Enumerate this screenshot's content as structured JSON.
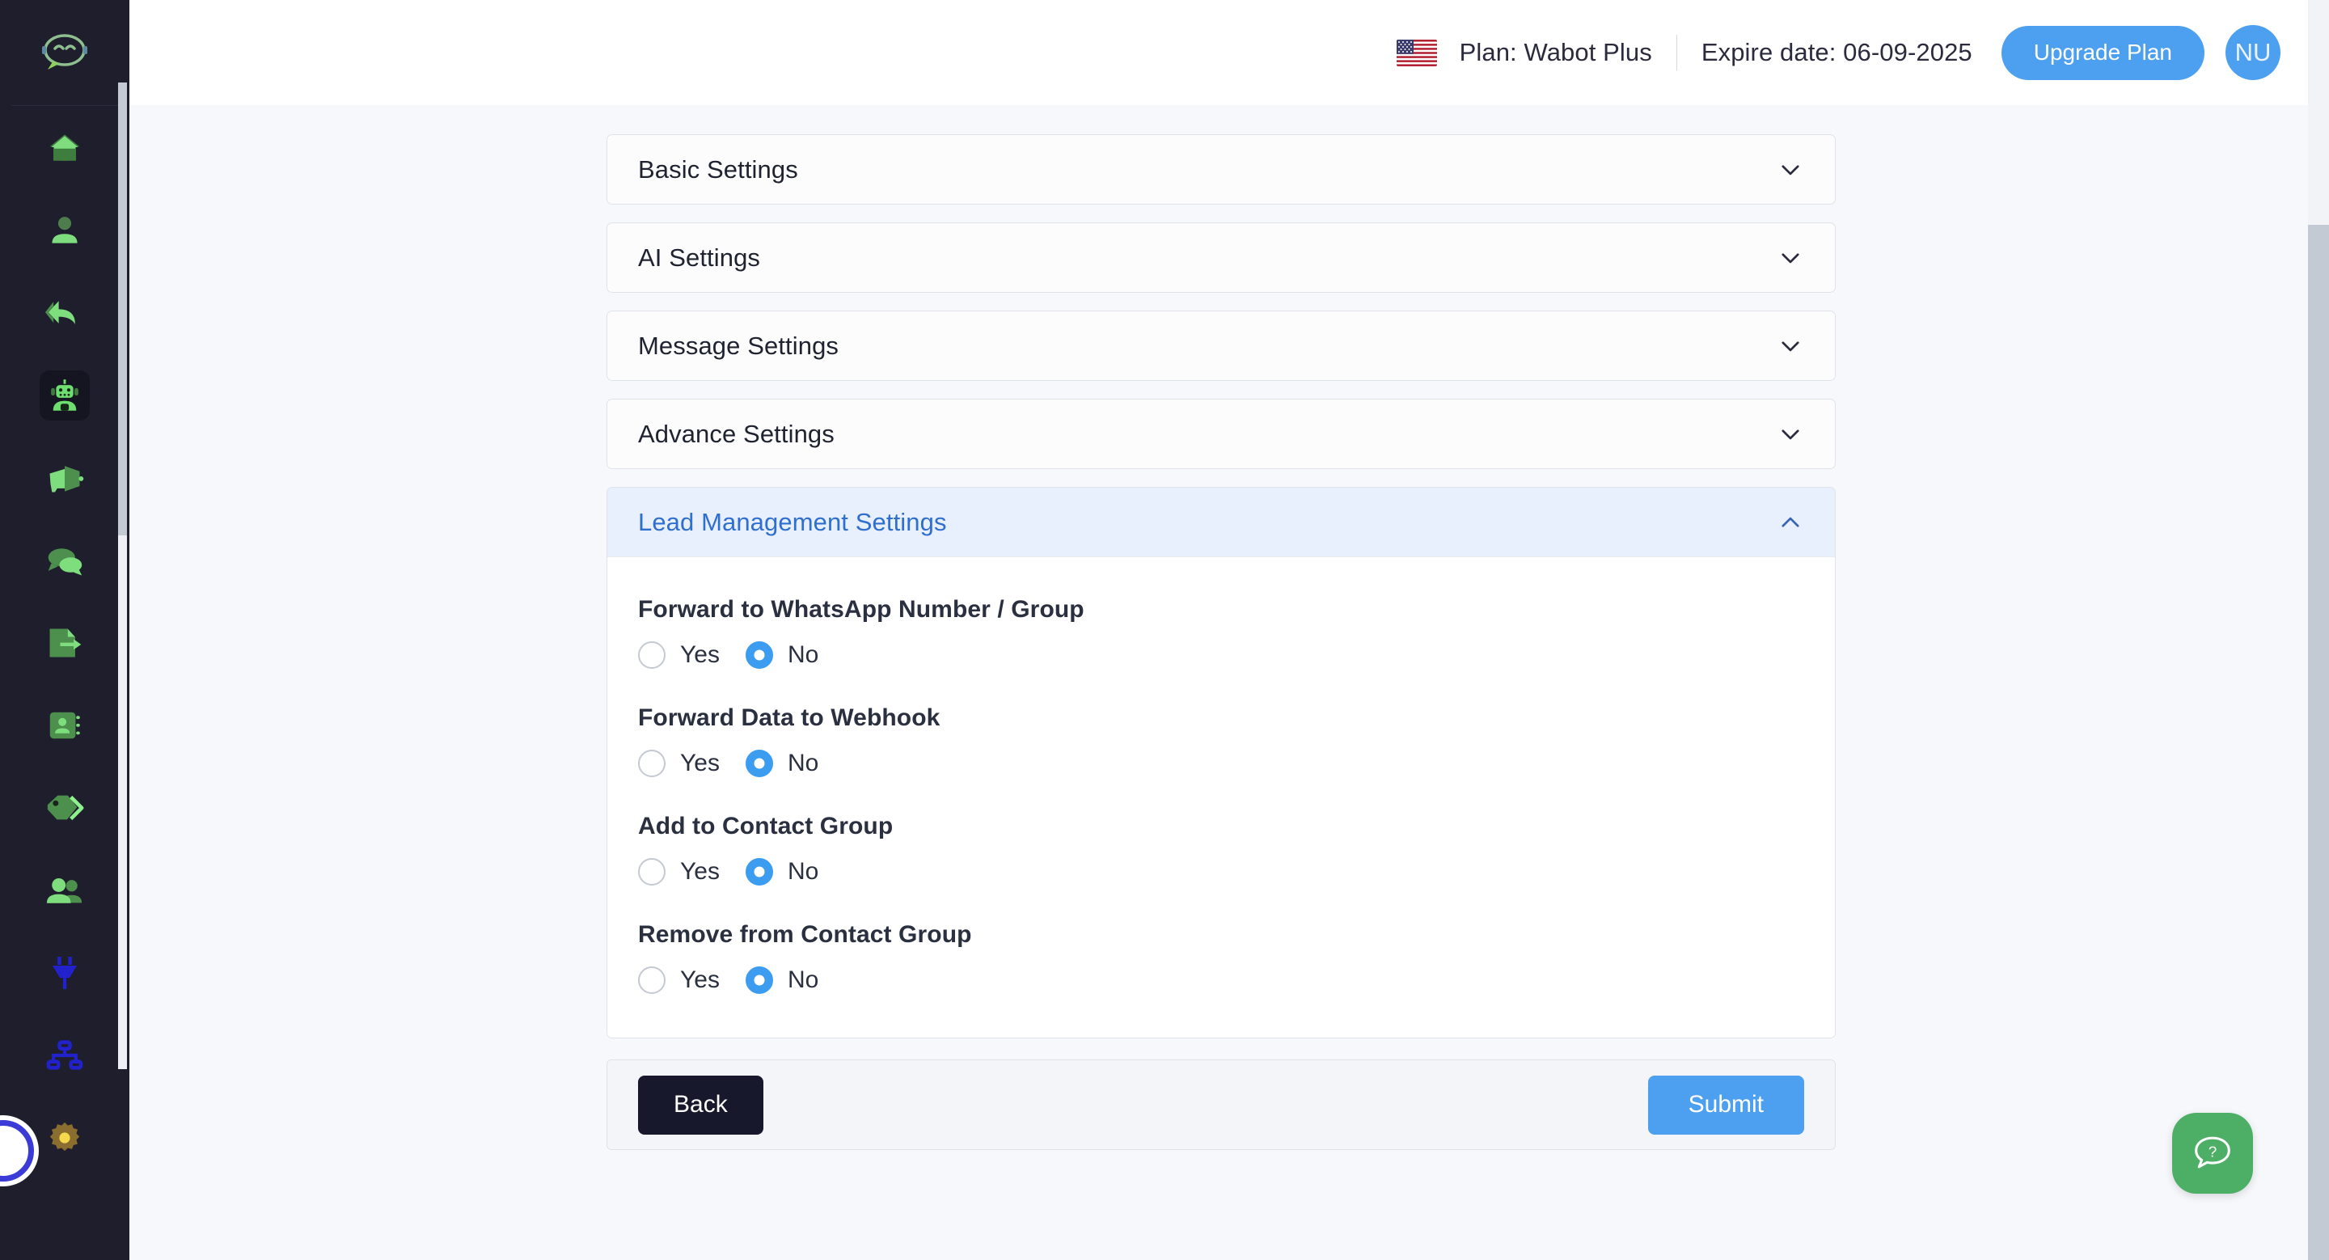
{
  "sidebar": {
    "logo_icon": "chat-bubble-logo-icon",
    "items": [
      {
        "icon": "home-icon",
        "name": "home",
        "active": false
      },
      {
        "icon": "user-icon",
        "name": "user",
        "active": false
      },
      {
        "icon": "reply-all-icon",
        "name": "reply",
        "active": false
      },
      {
        "icon": "robot-icon",
        "name": "chatbot",
        "active": true
      },
      {
        "icon": "megaphone-icon",
        "name": "broadcast",
        "active": false
      },
      {
        "icon": "chats-icon",
        "name": "chats",
        "active": false
      },
      {
        "icon": "file-export-icon",
        "name": "export",
        "active": false
      },
      {
        "icon": "contact-book-icon",
        "name": "contacts",
        "active": false
      },
      {
        "icon": "tag-icon",
        "name": "tags",
        "active": false
      },
      {
        "icon": "users-group-icon",
        "name": "team",
        "active": false
      },
      {
        "icon": "plug-icon",
        "name": "integrations",
        "active": false
      },
      {
        "icon": "sitemap-icon",
        "name": "workflow",
        "active": false
      },
      {
        "icon": "gear-icon",
        "name": "settings",
        "active": false
      }
    ]
  },
  "topbar": {
    "flag_icon": "us-flag-icon",
    "plan": "Plan: Wabot Plus",
    "expire": "Expire date: 06-09-2025",
    "upgrade_label": "Upgrade Plan",
    "avatar_initials": "NU"
  },
  "accordions": [
    {
      "label": "Basic Settings",
      "icon": "chevron-down-icon",
      "open": false
    },
    {
      "label": "AI Settings",
      "icon": "chevron-down-icon",
      "open": false
    },
    {
      "label": "Message Settings",
      "icon": "chevron-down-icon",
      "open": false
    },
    {
      "label": "Advance Settings",
      "icon": "chevron-down-icon",
      "open": false
    }
  ],
  "lead_section": {
    "label": "Lead Management Settings",
    "icon": "chevron-up-icon",
    "open": true,
    "fields": [
      {
        "label": "Forward to WhatsApp Number / Group",
        "yes": "Yes",
        "no": "No",
        "selected": "No"
      },
      {
        "label": "Forward Data to Webhook",
        "yes": "Yes",
        "no": "No",
        "selected": "No"
      },
      {
        "label": "Add to Contact Group",
        "yes": "Yes",
        "no": "No",
        "selected": "No"
      },
      {
        "label": "Remove from Contact Group",
        "yes": "Yes",
        "no": "No",
        "selected": "No"
      }
    ]
  },
  "footer": {
    "back_label": "Back",
    "submit_label": "Submit"
  },
  "help": {
    "icon": "question-chat-icon"
  },
  "colors": {
    "sidebar_bg": "#1e1e2d",
    "accent_blue": "#4da0ef",
    "active_header_bg": "#e8f0fd",
    "active_header_text": "#2f6fd0",
    "back_btn": "#17182b",
    "help_green": "#4caf65",
    "sidebar_icon_green": "#6ecf6e"
  }
}
